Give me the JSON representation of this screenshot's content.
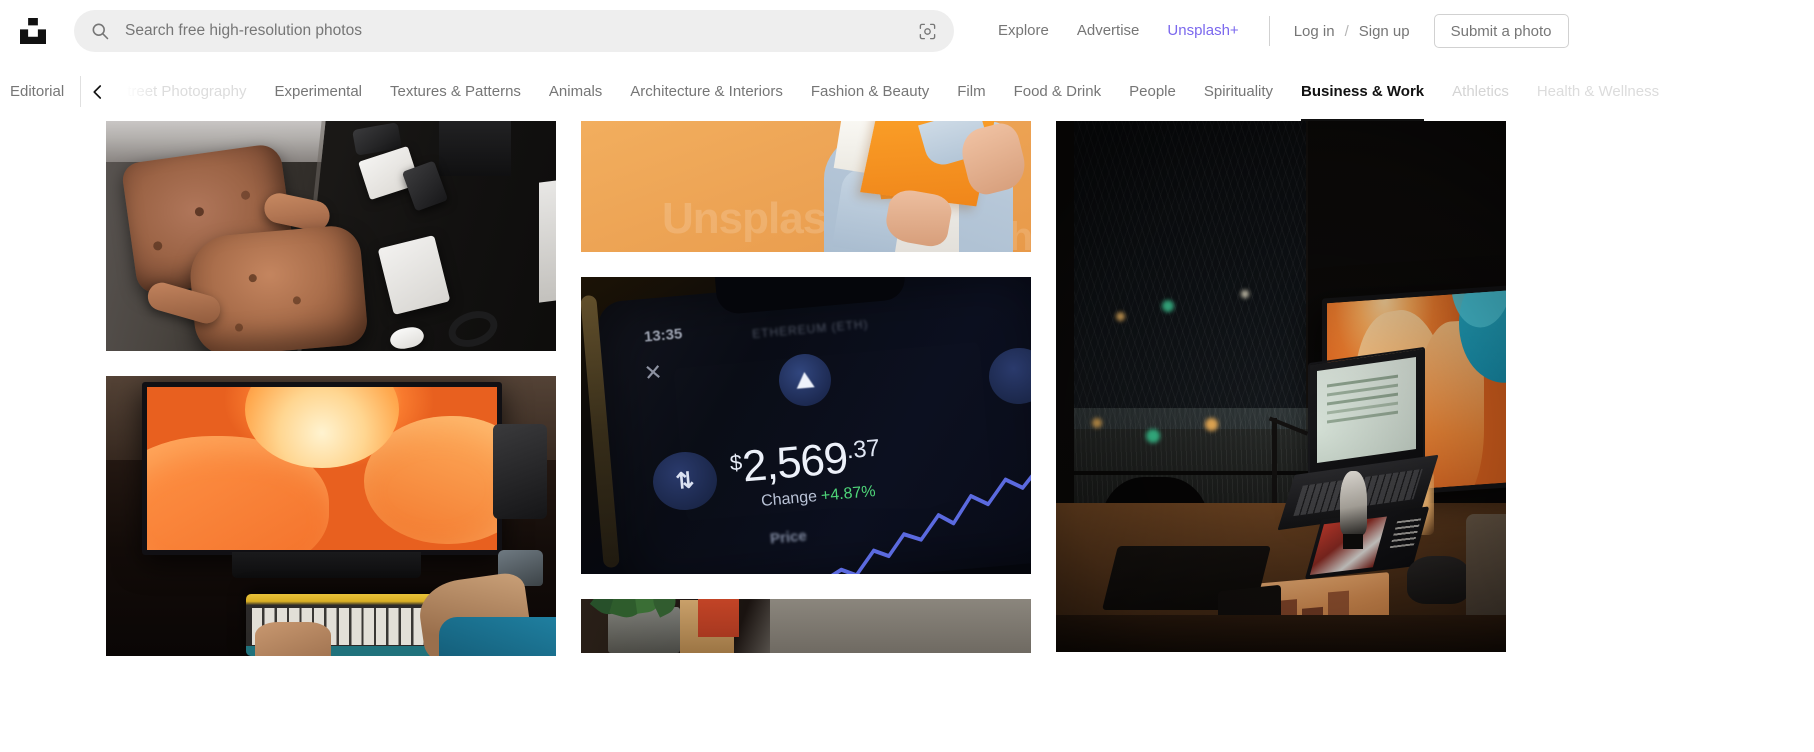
{
  "header": {
    "logo_name": "unsplash-logo",
    "search": {
      "placeholder": "Search free high-resolution photos",
      "value": "",
      "search_icon": "search-icon",
      "visual_search_icon": "visual-search-icon"
    },
    "links": [
      {
        "label": "Explore",
        "style": "default"
      },
      {
        "label": "Advertise",
        "style": "default"
      },
      {
        "label": "Unsplash+",
        "style": "plus"
      }
    ],
    "auth": {
      "login_label": "Log in",
      "separator": "/",
      "signup_label": "Sign up",
      "submit_label": "Submit a photo"
    }
  },
  "category_nav": {
    "editorial_label": "Editorial",
    "back_arrow_icon": "chevron-left-icon",
    "items": [
      {
        "label": "Street Photography",
        "state": "faded"
      },
      {
        "label": "Experimental",
        "state": "default"
      },
      {
        "label": "Textures & Patterns",
        "state": "default"
      },
      {
        "label": "Animals",
        "state": "default"
      },
      {
        "label": "Architecture & Interiors",
        "state": "default"
      },
      {
        "label": "Fashion & Beauty",
        "state": "default"
      },
      {
        "label": "Film",
        "state": "default"
      },
      {
        "label": "Food & Drink",
        "state": "default"
      },
      {
        "label": "People",
        "state": "default"
      },
      {
        "label": "Spirituality",
        "state": "default"
      },
      {
        "label": "Business & Work",
        "state": "active"
      },
      {
        "label": "Athletics",
        "state": "dim"
      },
      {
        "label": "Health & Wellness",
        "state": "faded"
      }
    ]
  },
  "grid": {
    "columns": [
      {
        "photos": [
          {
            "id": "photo-brown-office-chair-desk",
            "alt": "Brown leather office chair beside a dark desk with keyboard, mouse and headphones"
          },
          {
            "id": "photo-monitor-orange-wallpaper-keyboard",
            "alt": "Hands typing on a yellow mechanical keyboard in front of a monitor showing orange abstract wallpaper"
          }
        ]
      },
      {
        "photos": [
          {
            "id": "photo-woman-orange-folder",
            "alt": "Woman in denim shirt holding an orange folder against an orange background"
          },
          {
            "id": "photo-crypto-phone",
            "alt": "Close up of a smartphone showing an Ethereum price screen"
          },
          {
            "id": "photo-plant-desk-crop",
            "alt": "Green plant in a glass beside a red and wooden block on a desk"
          }
        ]
      },
      {
        "photos": [
          {
            "id": "photo-night-desk-setup",
            "alt": "Night time desk setup with laptop, tablet and monitor showing orange wallpaper beside a rainy window"
          }
        ]
      }
    ]
  },
  "crypto_screen": {
    "time": "13:35",
    "close_icon": "close-x-icon",
    "coin_icon": "ethereum-icon",
    "title": "ETHEREUM (ETH)",
    "currency_symbol": "$",
    "price_whole": "2,569",
    "price_cents": ".37",
    "change_label": "Change",
    "change_value": "+4.87%",
    "price_tab_label": "Price",
    "swap_icon": "swap-arrows-icon"
  },
  "colors": {
    "accent_plus": "#7b68ee",
    "search_bg": "#eeeeee",
    "text_muted": "#767676",
    "text_dark": "#111111",
    "change_positive": "#4fd679",
    "wallpaper_orange": "#f4802f"
  }
}
